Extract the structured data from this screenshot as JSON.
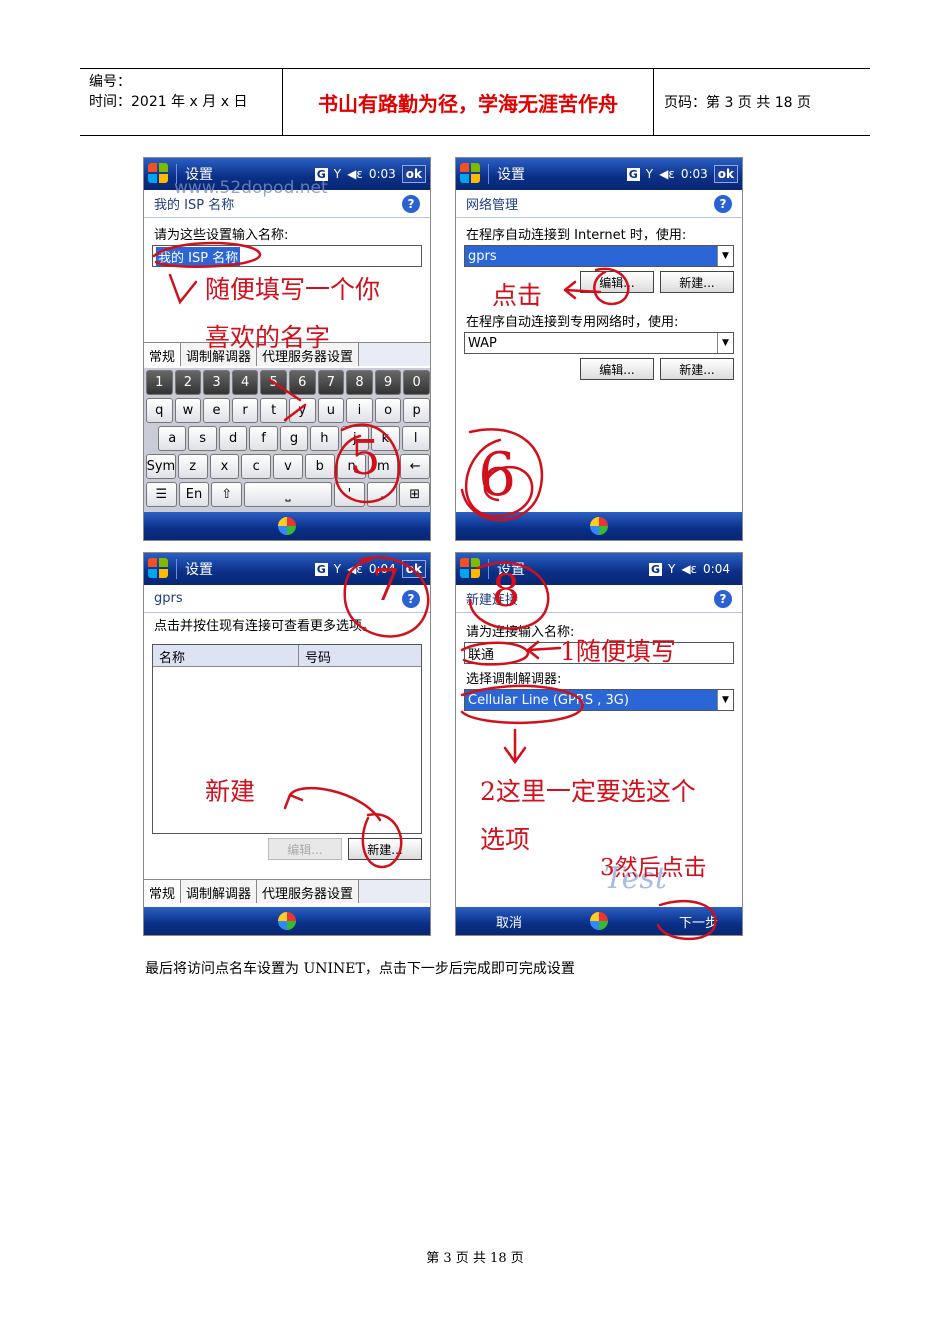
{
  "header": {
    "number_label": "编号：",
    "date_label": "时间：2021 年 x 月 x 日",
    "motto": "书山有路勤为径，学海无涯苦作舟",
    "page_label": "页码：第 3 页  共 18 页"
  },
  "screen1": {
    "title": "设置",
    "time": "0:03",
    "ok": "ok",
    "subtitle": "我的 ISP 名称",
    "watermark": "www.52dopod.net",
    "prompt": "请为这些设置输入名称:",
    "input_value": "我的 ISP 名称",
    "tabs": [
      "常规",
      "调制解调器",
      "代理服务器设置"
    ],
    "keys_row1": [
      "1",
      "2",
      "3",
      "4",
      "5",
      "6",
      "7",
      "8",
      "9",
      "0"
    ],
    "keys_row2": [
      "q",
      "w",
      "e",
      "r",
      "t",
      "y",
      "u",
      "i",
      "o",
      "p"
    ],
    "keys_row3": [
      "a",
      "s",
      "d",
      "f",
      "g",
      "h",
      "j",
      "k",
      "l"
    ],
    "keys_row4": [
      "Sym",
      "z",
      "x",
      "c",
      "v",
      "b",
      "n",
      "m",
      "←"
    ],
    "keys_row5": [
      "☰",
      "En",
      "⇧",
      "⎵",
      "'",
      ".",
      "⊞"
    ],
    "annotation": "随便填写一个你喜欢的名字",
    "annotation_line1": "随便填写一个你",
    "annotation_line2": "喜欢的名字"
  },
  "screen2": {
    "title": "设置",
    "time": "0:03",
    "ok": "ok",
    "subtitle": "网络管理",
    "prompt1": "在程序自动连接到 Internet 时，使用:",
    "combo1": "gprs",
    "prompt2": "在程序自动连接到专用网络时，使用:",
    "combo2": "WAP",
    "edit_btn": "编辑...",
    "new_btn": "新建...",
    "annotation": "点击"
  },
  "screen3": {
    "title": "设置",
    "time": "0:04",
    "ok": "ok",
    "subtitle": "gprs",
    "hint": "点击并按住现有连接可查看更多选项。",
    "col_name": "名称",
    "col_number": "号码",
    "edit_btn": "编辑...",
    "new_btn": "新建...",
    "tabs": [
      "常规",
      "调制解调器",
      "代理服务器设置"
    ],
    "annotation": "新建"
  },
  "screen4": {
    "title": "设置",
    "time": "0:04",
    "subtitle": "新建连接",
    "prompt1": "请为连接输入名称:",
    "name_value": "联通",
    "prompt2": "选择调制解调器:",
    "modem_value": "Cellular Line (GPRS , 3G)",
    "cancel": "取消",
    "next": "下一步",
    "annotation1": "1随便填写",
    "annotation2_line1": "2这里一定要选这个",
    "annotation2_line2": "选项",
    "annotation3": "3然后点击"
  },
  "step_numbers": [
    "5",
    "6",
    "7",
    "8"
  ],
  "caption": "最后将访问点名车设置为 UNINET，点击下一步后完成即可完成设置",
  "footer": "第 3 页 共 18 页"
}
